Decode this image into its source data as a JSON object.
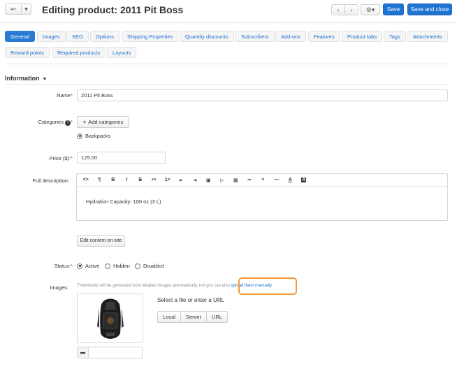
{
  "header": {
    "back_icon": "↩",
    "dropdown_icon": "▾",
    "title": "Editing product: 2011 Pit Boss",
    "prev_icon": "‹",
    "next_icon": "›",
    "gear_icon": "⚙▾",
    "save_label": "Save",
    "save_close_label": "Save and close",
    "accent": "#1f74d2"
  },
  "tabs": [
    {
      "label": "General",
      "active": true
    },
    {
      "label": "Images"
    },
    {
      "label": "SEO"
    },
    {
      "label": "Options"
    },
    {
      "label": "Shipping Properties"
    },
    {
      "label": "Quantity discounts"
    },
    {
      "label": "Subscribers"
    },
    {
      "label": "Add-ons"
    },
    {
      "label": "Features"
    },
    {
      "label": "Product tabs"
    },
    {
      "label": "Tags"
    },
    {
      "label": "Attachments"
    },
    {
      "label": "Reward points"
    },
    {
      "label": "Required products"
    },
    {
      "label": "Layouts"
    }
  ],
  "section": {
    "title": "Information",
    "caret": "▼"
  },
  "form": {
    "name_label": "Name",
    "name_value": "2011 Pit Boss",
    "required_mark": "*",
    "categories_label": "Categories",
    "help_icon": "?",
    "add_categories_label": "Add categories",
    "add_icon": "+",
    "category_selected": "Backpacks",
    "price_label": "Price ($):",
    "price_value": "125.00",
    "description_label": "Full description:",
    "description_text": "Hydration Capacity: 100 oz (3 L)",
    "toolbar_icons": [
      "<>",
      "¶",
      "B",
      "I",
      "S",
      "•≡",
      "1≡",
      "⇤",
      "⇥",
      "▣",
      "▷",
      "▦",
      "∞",
      "≡",
      "—",
      "A",
      "A"
    ],
    "edit_onsite_label": "Edit content on-site",
    "status_label": "Status:",
    "status_options": [
      "Active",
      "Hidden",
      "Disabled"
    ],
    "status_selected": "Active",
    "images_label": "Images:",
    "images_hint": "Thumbnails will be generated from detailed images automatically, but you can also",
    "images_hint_link": "upload them manually.",
    "url_label": "Select a file or enter a URL",
    "source_buttons": [
      "Local",
      "Server",
      "URL"
    ],
    "comment_icon": "▬"
  },
  "colors": {
    "highlight": "#f29a2e",
    "link": "#1b6fc9",
    "required": "#d9342b"
  }
}
